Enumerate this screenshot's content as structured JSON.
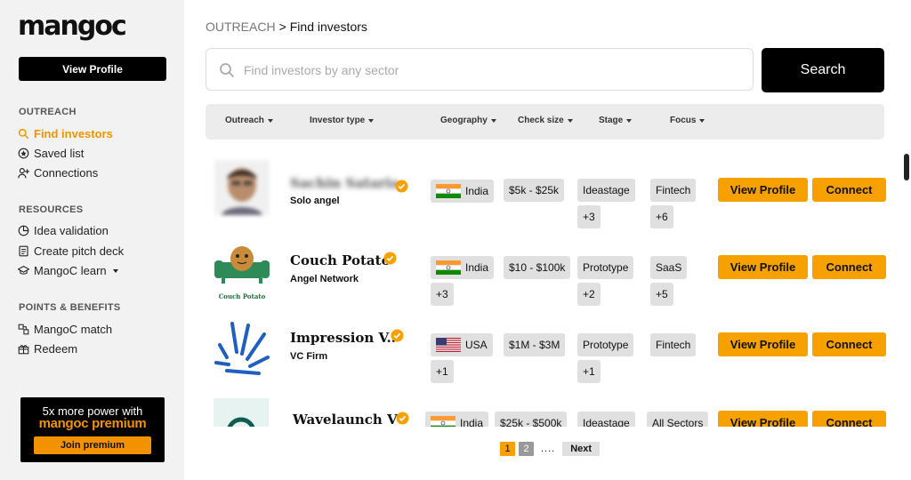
{
  "brand": {
    "logo_text": "mangoc",
    "view_profile_label": "View Profile"
  },
  "sidebar": {
    "sections": [
      {
        "title": "OUTREACH",
        "items": [
          {
            "label": "Find investors",
            "icon": "search-icon",
            "active": true
          },
          {
            "label": "Saved list",
            "icon": "star-circle-icon"
          },
          {
            "label": "Connections",
            "icon": "user-plus-icon"
          }
        ]
      },
      {
        "title": "RESOURCES",
        "items": [
          {
            "label": "Idea validation",
            "icon": "pie-chart-icon"
          },
          {
            "label": "Create pitch deck",
            "icon": "document-icon"
          },
          {
            "label": "MangoC learn",
            "icon": "graduation-cap-icon"
          }
        ]
      },
      {
        "title": "POINTS & BENEFITS",
        "items": [
          {
            "label": "MangoC match",
            "icon": "match-icon"
          },
          {
            "label": "Redeem",
            "icon": "gift-icon"
          }
        ]
      }
    ],
    "promo": {
      "line1": "5x more power with",
      "line2": "mangoc premium",
      "button": "Join premium"
    }
  },
  "breadcrumb": {
    "section": "OUTREACH",
    "separator": ">",
    "page": "Find investors"
  },
  "search": {
    "placeholder": "Find investors by any sector",
    "value": "",
    "button": "Search"
  },
  "filters": [
    "Outreach",
    "Investor type",
    "Geography",
    "Check size",
    "Stage",
    "Focus"
  ],
  "investors": [
    {
      "name": "Sachin Sataria",
      "type": "Solo angel",
      "country": "India",
      "check": "$5k - $25k",
      "stage": "Ideastage",
      "stage_more": "+3",
      "focus": "Fintech",
      "focus_more": "+6",
      "geo_more": ""
    },
    {
      "name": "Couch Potato",
      "type": "Angel Network",
      "country": "India",
      "check": "$10 - $100k",
      "stage": "Prototype",
      "stage_more": "+2",
      "focus": "SaaS",
      "focus_more": "+5",
      "geo_more": "+3",
      "logo_caption": "Couch Potato"
    },
    {
      "name": "Impression V..",
      "type": "VC Firm",
      "country": "USA",
      "check": "$1M - $3M",
      "stage": "Prototype",
      "stage_more": "+1",
      "focus": "Fintech",
      "focus_more": "",
      "geo_more": "+1"
    },
    {
      "name": "Wavelaunch Vc",
      "type": "",
      "country": "India",
      "check": "$25k - $500k",
      "stage": "Ideastage",
      "stage_more": "",
      "focus": "All Sectors",
      "focus_more": "",
      "geo_more": ""
    }
  ],
  "row_actions": {
    "view_profile": "View Profile",
    "connect": "Connect"
  },
  "pagination": {
    "pages": [
      "1",
      "2"
    ],
    "current": "1",
    "dots": "....",
    "next": "Next"
  },
  "colors": {
    "accent": "#f7a100",
    "dark": "#000000",
    "sidebar_bg": "#f2f2f2",
    "tag_bg": "#e0e0e0"
  }
}
